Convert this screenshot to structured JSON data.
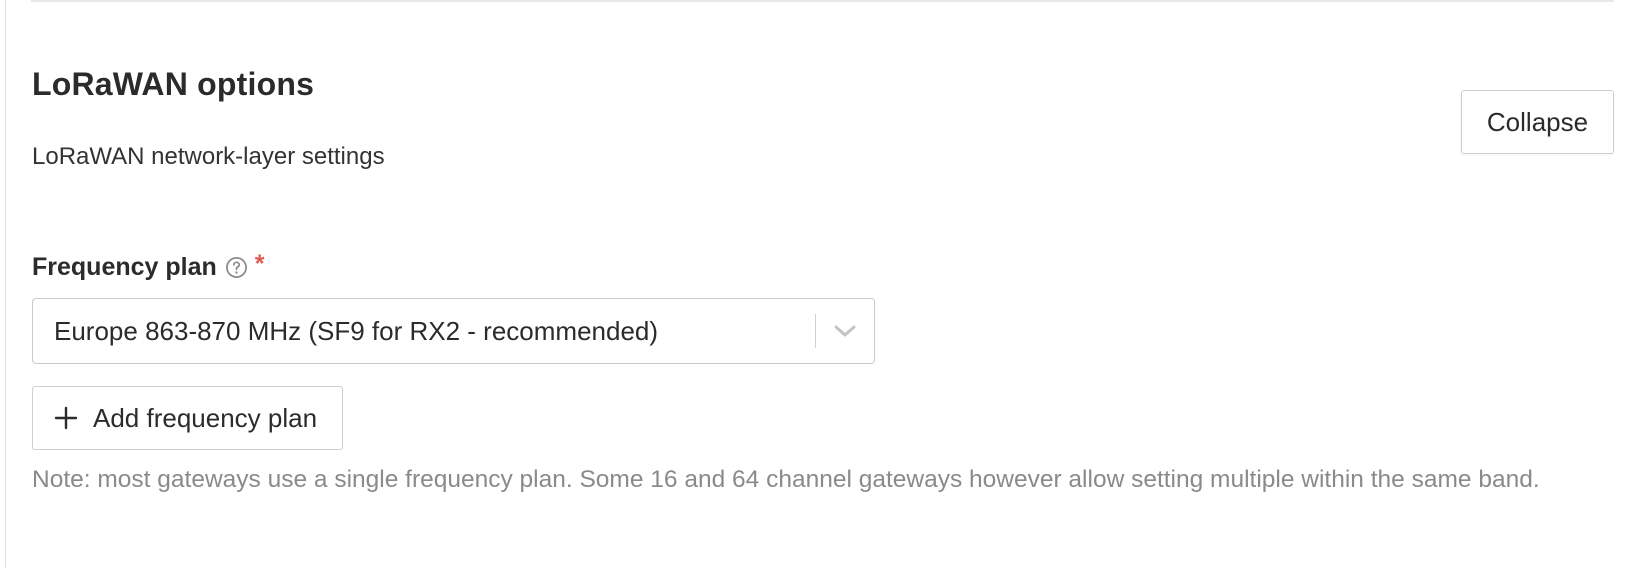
{
  "section": {
    "title": "LoRaWAN options",
    "subtitle": "LoRaWAN network-layer settings",
    "collapse_label": "Collapse"
  },
  "frequency_plan": {
    "label": "Frequency plan",
    "required_marker": "*",
    "help_icon": "question-circle-icon",
    "selected_value": "Europe 863-870 MHz (SF9 for RX2 - recommended)",
    "dropdown_icon": "chevron-down-icon",
    "add_button_label": "Add frequency plan",
    "add_icon": "plus-icon",
    "note": "Note: most gateways use a single frequency plan. Some 16 and 64 channel gateways however allow setting multiple within the same band."
  },
  "colors": {
    "required": "#e05a4f",
    "note_text": "#8a8a8a",
    "border": "#c9c9c9",
    "text": "#2b2b2b"
  }
}
